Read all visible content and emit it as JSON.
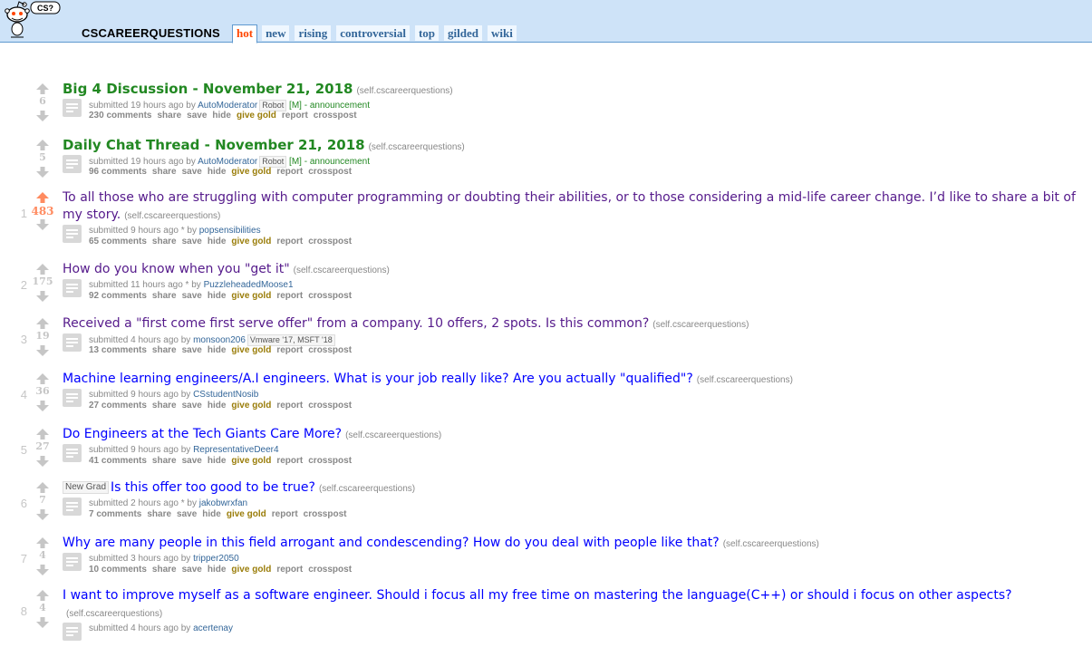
{
  "header": {
    "logo_text": "CS?",
    "subreddit": "CSCAREERQUESTIONS",
    "tabs": [
      "hot",
      "new",
      "rising",
      "controversial",
      "top",
      "gilded",
      "wiki"
    ],
    "selected_tab": "hot"
  },
  "post_buttons": {
    "share": "share",
    "save": "save",
    "hide": "hide",
    "give_gold": "give gold",
    "report": "report",
    "crosspost": "crosspost"
  },
  "posts": [
    {
      "rank": "",
      "score": "6",
      "style": "sticky",
      "link_flair": "",
      "title": "Big 4 Discussion - November 21, 2018",
      "domain": "(self.cscareerquestions)",
      "tagline_prefix": "submitted 19 hours ago by",
      "author": "AutoModerator",
      "user_flair": "Robot",
      "distinguish": "[M] - announcement",
      "comments": "230 comments"
    },
    {
      "rank": "",
      "score": "5",
      "style": "sticky",
      "link_flair": "",
      "title": "Daily Chat Thread - November 21, 2018",
      "domain": "(self.cscareerquestions)",
      "tagline_prefix": "submitted 19 hours ago by",
      "author": "AutoModerator",
      "user_flair": "Robot",
      "distinguish": "[M] - announcement",
      "comments": "96 comments"
    },
    {
      "rank": "1",
      "score": "483",
      "style": "visited",
      "upvoted": true,
      "link_flair": "",
      "title": "To all those who are struggling with computer programming or doubting their abilities, or to those considering a mid-life career change. I’d like to share a bit of my story.",
      "domain": "(self.cscareerquestions)",
      "tagline_prefix": "submitted 9 hours ago * by",
      "author": "popsensibilities",
      "user_flair": "",
      "distinguish": "",
      "comments": "65 comments"
    },
    {
      "rank": "2",
      "score": "175",
      "style": "visited",
      "link_flair": "",
      "title": "How do you know when you \"get it\"",
      "domain": "(self.cscareerquestions)",
      "tagline_prefix": "submitted 11 hours ago * by",
      "author": "PuzzleheadedMoose1",
      "user_flair": "",
      "distinguish": "",
      "comments": "92 comments"
    },
    {
      "rank": "3",
      "score": "19",
      "style": "visited",
      "link_flair": "",
      "title": "Received a \"first come first serve offer\" from a company. 10 offers, 2 spots. Is this common?",
      "domain": "(self.cscareerquestions)",
      "tagline_prefix": "submitted 4 hours ago by",
      "author": "monsoon206",
      "user_flair": "Vmware '17, MSFT '18",
      "distinguish": "",
      "comments": "13 comments"
    },
    {
      "rank": "4",
      "score": "36",
      "style": "unread",
      "link_flair": "",
      "title": "Machine learning engineers/A.I engineers. What is your job really like? Are you actually \"qualified\"?",
      "domain": "(self.cscareerquestions)",
      "tagline_prefix": "submitted 9 hours ago by",
      "author": "CSstudentNosib",
      "user_flair": "",
      "distinguish": "",
      "comments": "27 comments"
    },
    {
      "rank": "5",
      "score": "27",
      "style": "unread",
      "link_flair": "",
      "title": "Do Engineers at the Tech Giants Care More?",
      "domain": "(self.cscareerquestions)",
      "tagline_prefix": "submitted 9 hours ago by",
      "author": "RepresentativeDeer4",
      "user_flair": "",
      "distinguish": "",
      "comments": "41 comments"
    },
    {
      "rank": "6",
      "score": "7",
      "style": "unread",
      "link_flair": "New Grad",
      "title": "Is this offer too good to be true?",
      "domain": "(self.cscareerquestions)",
      "tagline_prefix": "submitted 2 hours ago * by",
      "author": "jakobwrxfan",
      "user_flair": "",
      "distinguish": "",
      "comments": "7 comments"
    },
    {
      "rank": "7",
      "score": "4",
      "style": "unread",
      "link_flair": "",
      "title": "Why are many people in this field arrogant and condescending? How do you deal with people like that?",
      "domain": "(self.cscareerquestions)",
      "tagline_prefix": "submitted 3 hours ago by",
      "author": "tripper2050",
      "user_flair": "",
      "distinguish": "",
      "comments": "10 comments"
    },
    {
      "rank": "8",
      "score": "4",
      "style": "unread",
      "link_flair": "",
      "title": "I want to improve myself as a software engineer. Should i focus all my free time on mastering the language(C++) or should i focus on other aspects?",
      "domain": "(self.cscareerquestions)",
      "tagline_prefix": "submitted 4 hours ago by",
      "author": "acertenay",
      "user_flair": "",
      "distinguish": "",
      "comments": ""
    }
  ]
}
